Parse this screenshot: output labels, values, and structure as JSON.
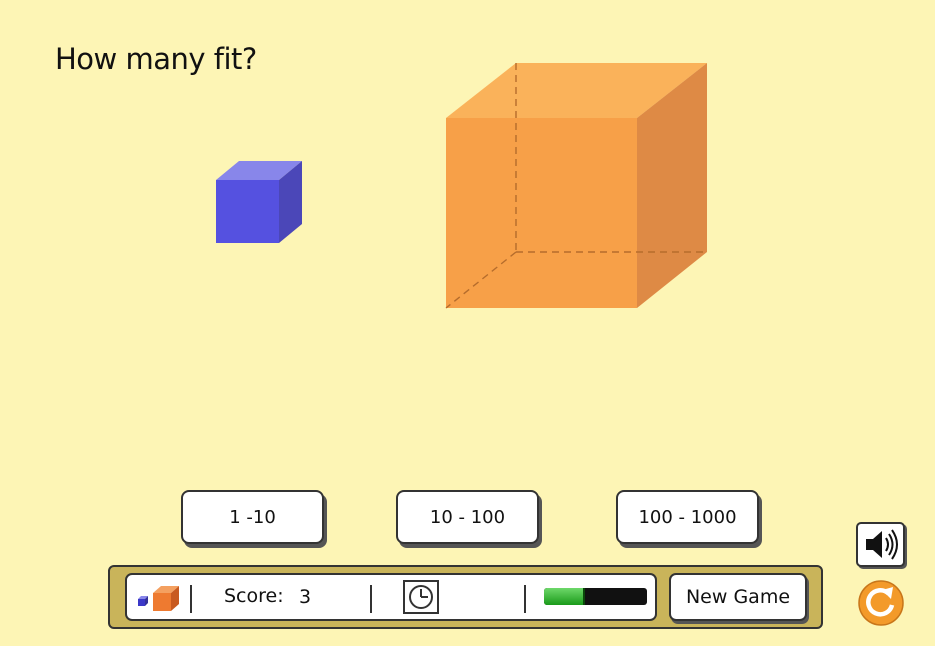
{
  "question": "How many fit?",
  "answers": [
    "1 -10",
    "10 - 100",
    "100 - 1000"
  ],
  "status": {
    "score_label": "Score:",
    "score_value": "3",
    "time_progress": 0.4
  },
  "new_game_label": "New Game",
  "colors": {
    "background": "#fdf5b5",
    "small_cube": "#5551e0",
    "big_cube": "#f7a048",
    "bar": "#c9b45a",
    "timer": "#2aa62a",
    "reset": "#f39a2a"
  },
  "icons": [
    "cubes-icon",
    "clock-icon",
    "speaker-icon",
    "reset-icon"
  ]
}
